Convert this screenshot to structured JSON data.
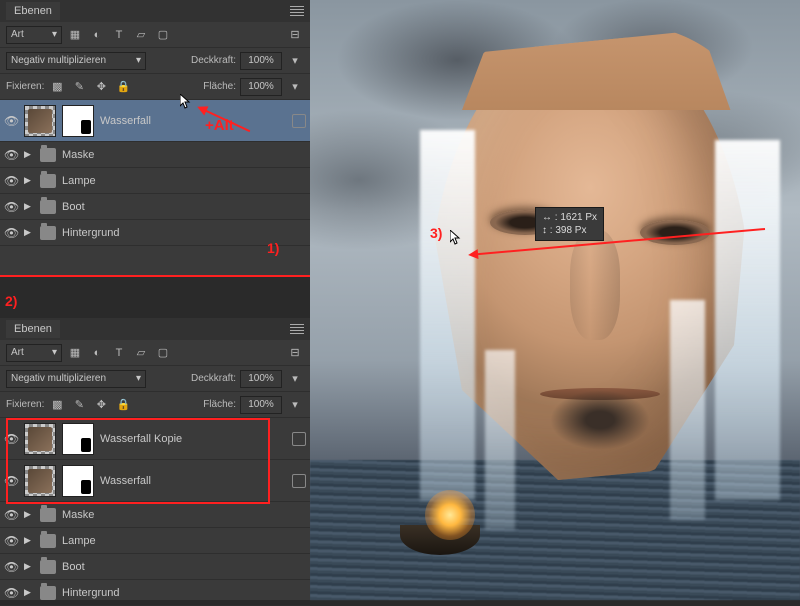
{
  "panel1": {
    "title": "Ebenen",
    "kind_filter": "Art",
    "blend_mode": "Negativ multiplizieren",
    "opacity_label": "Deckkraft:",
    "opacity_value": "100%",
    "lock_label": "Fixieren:",
    "fill_label": "Fläche:",
    "fill_value": "100%",
    "layers": [
      {
        "name": "Wasserfall",
        "type": "layer",
        "selected": true
      },
      {
        "name": "Maske",
        "type": "group"
      },
      {
        "name": "Lampe",
        "type": "group"
      },
      {
        "name": "Boot",
        "type": "group"
      },
      {
        "name": "Hintergrund",
        "type": "group"
      }
    ]
  },
  "panel2": {
    "title": "Ebenen",
    "kind_filter": "Art",
    "blend_mode": "Negativ multiplizieren",
    "opacity_label": "Deckkraft:",
    "opacity_value": "100%",
    "lock_label": "Fixieren:",
    "fill_label": "Fläche:",
    "fill_value": "100%",
    "layers": [
      {
        "name": "Wasserfall Kopie",
        "type": "layer"
      },
      {
        "name": "Wasserfall",
        "type": "layer"
      },
      {
        "name": "Maske",
        "type": "group"
      },
      {
        "name": "Lampe",
        "type": "group"
      },
      {
        "name": "Boot",
        "type": "group"
      },
      {
        "name": "Hintergrund",
        "type": "group"
      }
    ]
  },
  "annotations": {
    "alt": "+Alt",
    "step1": "1)",
    "step2": "2)",
    "step3": "3)"
  },
  "tooltip": {
    "line1": "↔ : 1621 Px",
    "line2": "↕ :   398 Px"
  }
}
